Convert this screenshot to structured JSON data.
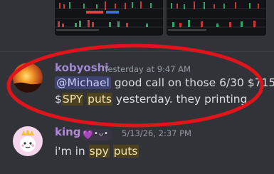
{
  "messages": [
    {
      "username": "kobyoshi",
      "timestamp": "Yesterday at 9:47 AM",
      "content": {
        "mention": "@Michael",
        "text1": " good call on those 6/30 $715",
        "text2a": "$",
        "spy": "SPY",
        "text2b": " ",
        "puts": "puts",
        "text2c": " yesterday.  they printing."
      }
    },
    {
      "username": "king",
      "badge_heart": "💜",
      "badge_face": "•ᴗ•",
      "timestamp": "5/13/26, 2:37 PM",
      "content": {
        "text1": "i'm in ",
        "spy": "spy",
        "text2": " ",
        "puts": "puts"
      }
    }
  ],
  "colors": {
    "background": "#313338",
    "annotation_ring": "#e0141b",
    "mention_bg": "#3d4270",
    "highlight_bg": "#4c4220"
  },
  "icons": {
    "avatar1": "sunset-avatar",
    "avatar2": "crowned-character-avatar"
  }
}
